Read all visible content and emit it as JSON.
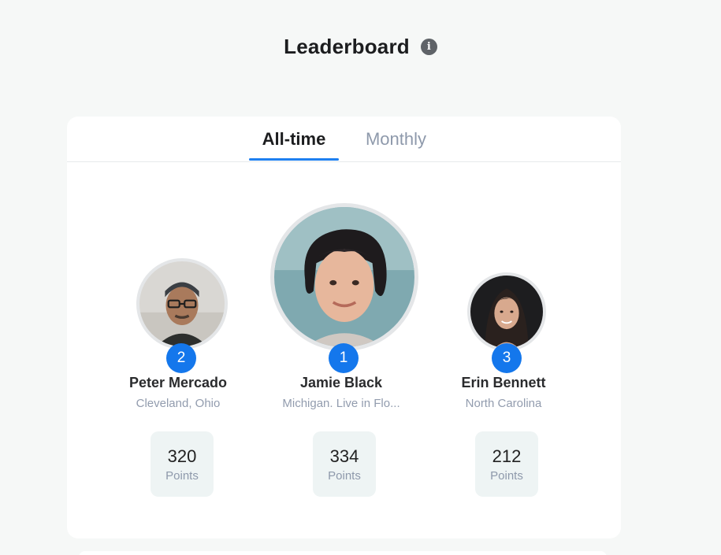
{
  "header": {
    "title": "Leaderboard",
    "info_icon": "info-icon"
  },
  "tabs": [
    {
      "label": "All-time",
      "active": true
    },
    {
      "label": "Monthly",
      "active": false
    }
  ],
  "leaders": [
    {
      "rank": "1",
      "name": "Jamie Black",
      "location": "Michigan. Live in Flo...",
      "points": "334",
      "points_label": "Points"
    },
    {
      "rank": "2",
      "name": "Peter Mercado",
      "location": "Cleveland, Ohio",
      "points": "320",
      "points_label": "Points"
    },
    {
      "rank": "3",
      "name": "Erin Bennett",
      "location": "North Carolina",
      "points": "212",
      "points_label": "Points"
    }
  ],
  "colors": {
    "accent": "#1e7ff0",
    "rank_badge": "#1477ec",
    "points_bg": "#eef4f4",
    "muted_text": "#929cae"
  }
}
